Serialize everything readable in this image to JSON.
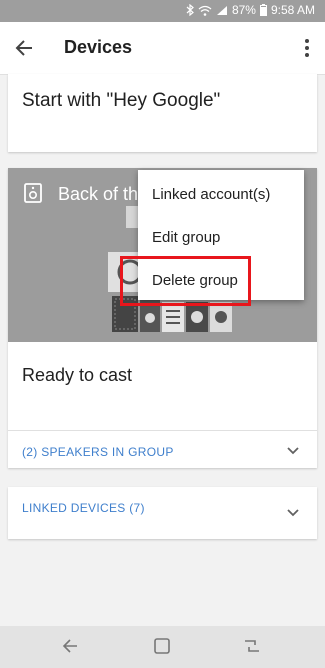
{
  "status_bar": {
    "battery": "87%",
    "time": "9:58 AM"
  },
  "app_bar": {
    "title": "Devices"
  },
  "hotword_card": {
    "text": "Start with \"Hey Google\""
  },
  "group_card": {
    "name": "Back of the",
    "status": "Ready to cast",
    "speakers_row": "(2) SPEAKERS IN GROUP"
  },
  "linked_card": {
    "label": "LINKED DEVICES (7)"
  },
  "context_menu": {
    "items": [
      "Linked account(s)",
      "Edit group",
      "Delete group"
    ],
    "highlighted_item": "Delete group"
  },
  "colors": {
    "accent": "#3f7fcc",
    "highlight": "#e8161c",
    "hero": "#9c9c9c",
    "status_bar": "#9e9e9e"
  }
}
